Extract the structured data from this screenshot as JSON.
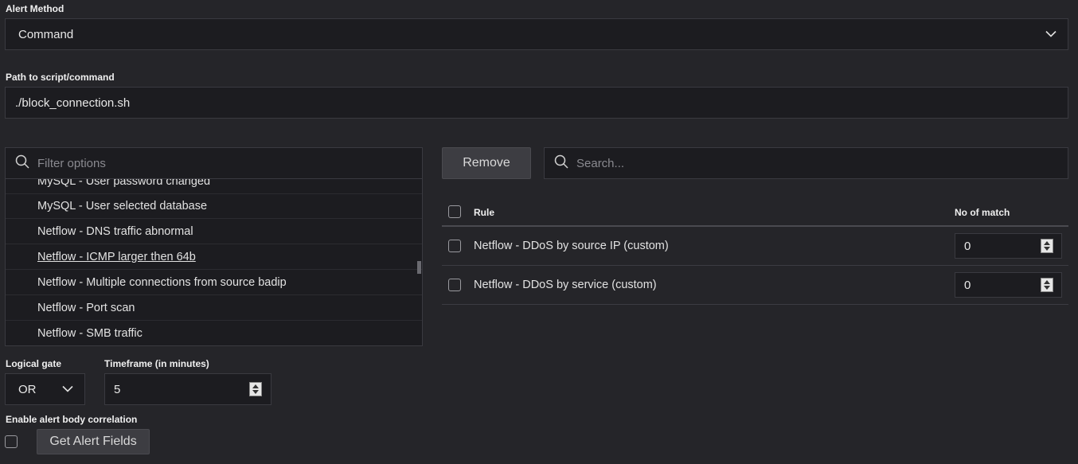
{
  "alert_method": {
    "label": "Alert Method",
    "value": "Command"
  },
  "path": {
    "label": "Path to script/command",
    "value": "./block_connection.sh"
  },
  "filter": {
    "placeholder": "Filter options",
    "items": [
      "MySQL - User password changed",
      "MySQL - User selected database",
      "Netflow - DNS traffic abnormal",
      "Netflow - ICMP larger then 64b",
      "Netflow - Multiple connections from source badip",
      "Netflow - Port scan",
      "Netflow - SMB traffic"
    ]
  },
  "remove_label": "Remove",
  "search": {
    "placeholder": "Search..."
  },
  "table": {
    "col_rule": "Rule",
    "col_match": "No of match",
    "rows": [
      {
        "rule": "Netflow - DDoS by source IP (custom)",
        "match": "0"
      },
      {
        "rule": "Netflow - DDoS by service (custom)",
        "match": "0"
      }
    ]
  },
  "logical_gate": {
    "label": "Logical gate",
    "value": "OR"
  },
  "timeframe": {
    "label": "Timeframe (in minutes)",
    "value": "5"
  },
  "correlation": {
    "label": "Enable alert body correlation",
    "button": "Get Alert Fields"
  }
}
